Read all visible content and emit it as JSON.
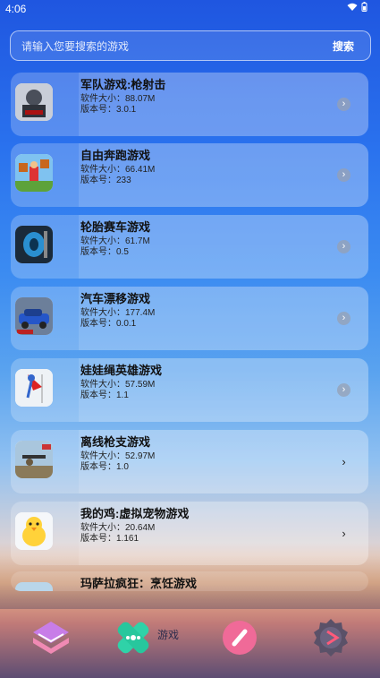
{
  "status": {
    "time": "4:06"
  },
  "search": {
    "placeholder": "请输入您要搜索的游戏",
    "button": "搜索"
  },
  "labels": {
    "size_prefix": "软件大小：",
    "version_prefix": "版本号："
  },
  "games": [
    {
      "name": "军队游戏:枪射击",
      "size": "88.07M",
      "version": "3.0.1"
    },
    {
      "name": "自由奔跑游戏",
      "size": "66.41M",
      "version": "233"
    },
    {
      "name": "轮胎赛车游戏",
      "size": "61.7M",
      "version": "0.5"
    },
    {
      "name": "汽车漂移游戏",
      "size": "177.4M",
      "version": "0.0.1"
    },
    {
      "name": "娃娃绳英雄游戏",
      "size": "57.59M",
      "version": "1.1"
    },
    {
      "name": "离线枪支游戏",
      "size": "52.97M",
      "version": "1.0"
    },
    {
      "name": "我的鸡:虚拟宠物游戏",
      "size": "20.64M",
      "version": "1.161"
    },
    {
      "name": "玛萨拉疯狂：烹饪游戏"
    }
  ],
  "bottom_nav": {
    "active_label": "游戏"
  }
}
